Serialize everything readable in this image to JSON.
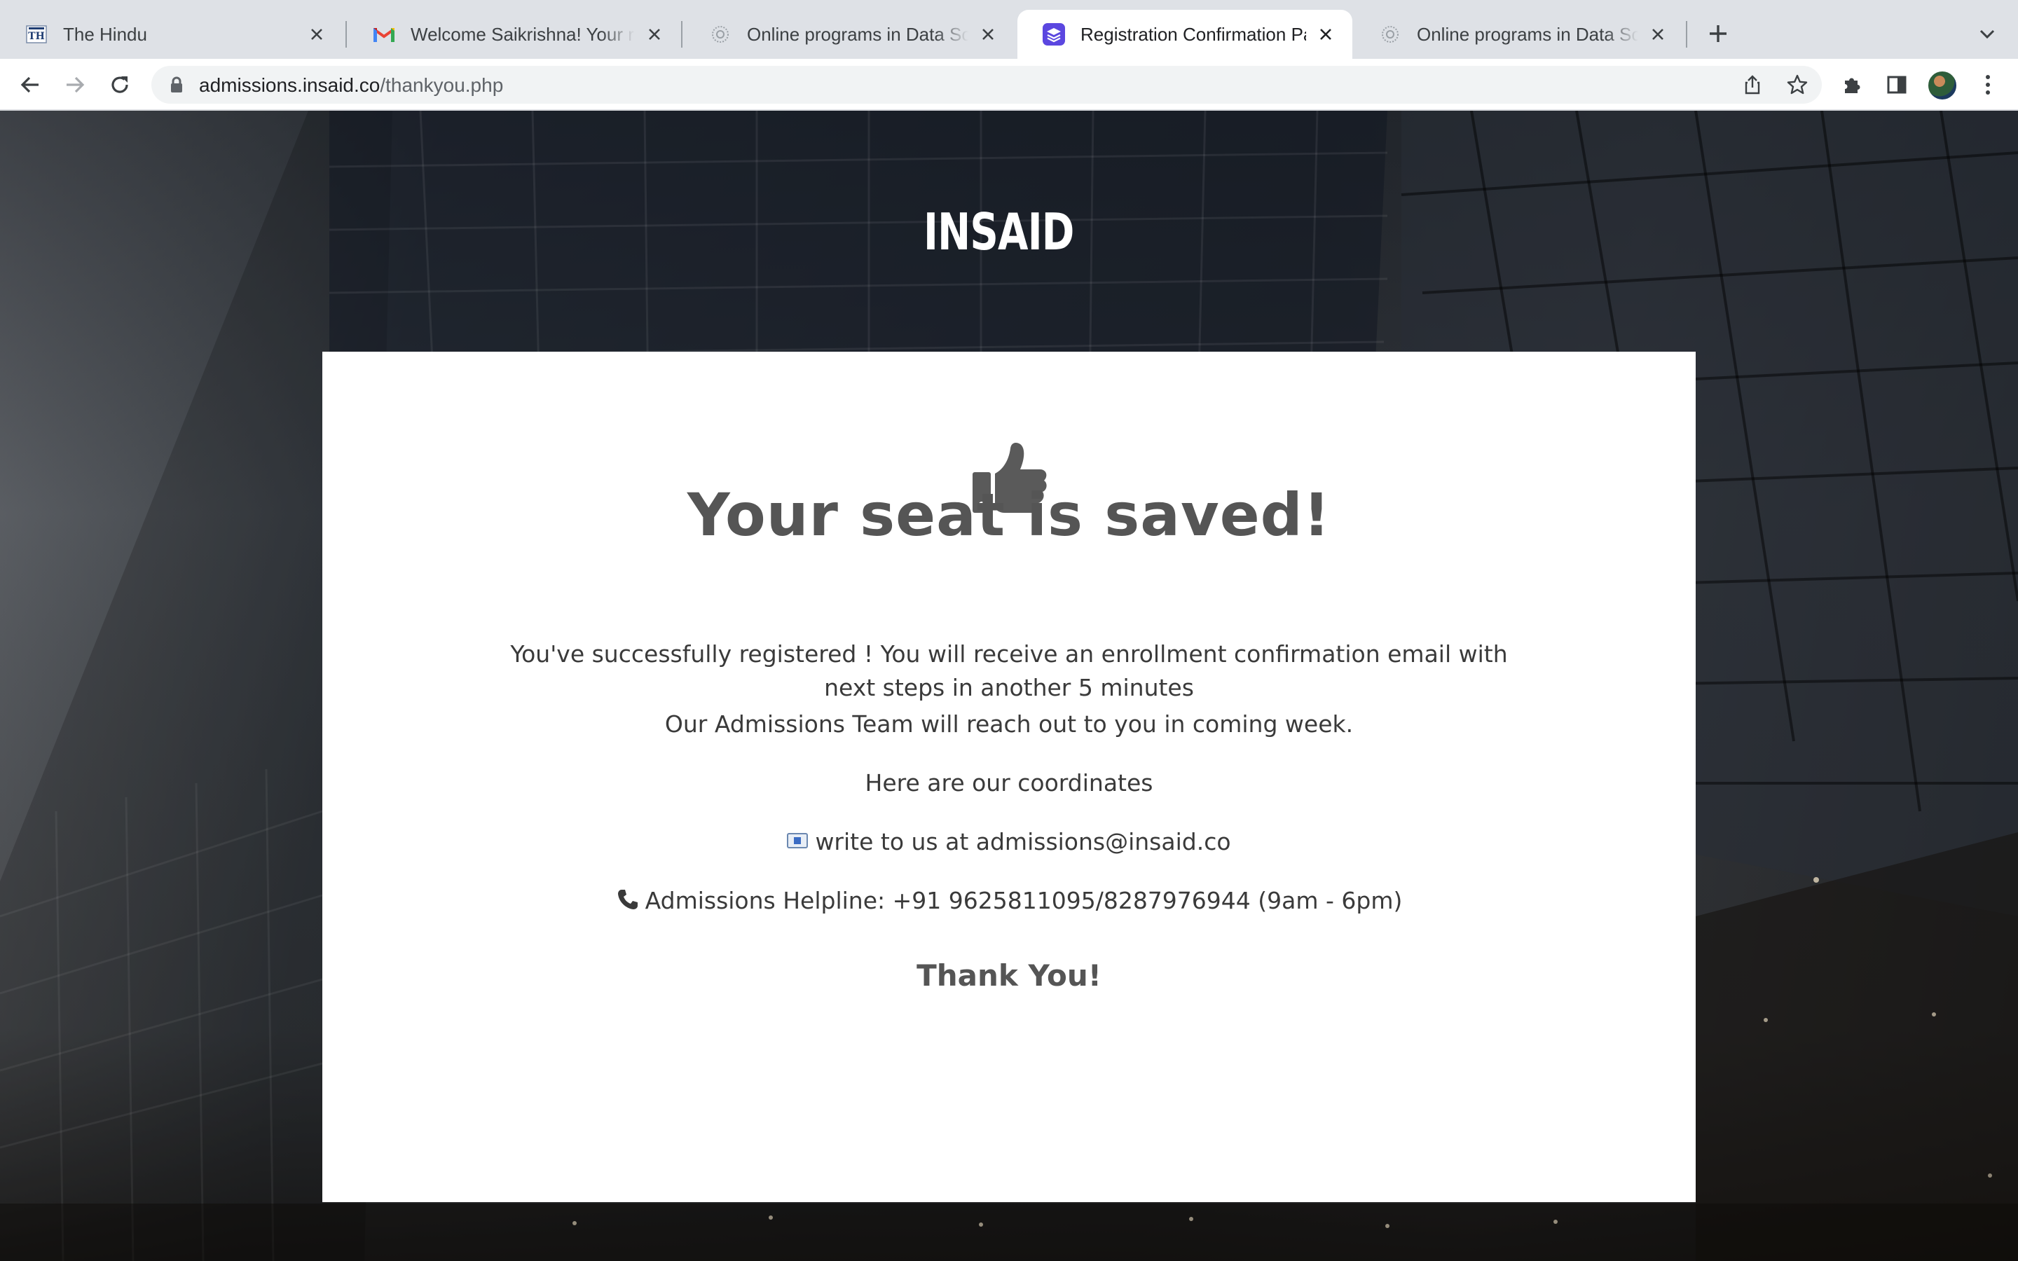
{
  "browser": {
    "tabs": [
      {
        "title": "The Hindu",
        "favicon": "the-hindu-favicon",
        "active": false
      },
      {
        "title": "Welcome Saikrishna! Your registration",
        "favicon": "gmail-favicon",
        "active": false
      },
      {
        "title": "Online programs in Data Science",
        "favicon": "insaid-favicon",
        "active": false
      },
      {
        "title": "Registration Confirmation Page",
        "favicon": "stack-favicon",
        "active": true
      },
      {
        "title": "Online programs in Data Science",
        "favicon": "insaid-favicon",
        "active": false
      }
    ],
    "address": {
      "domain": "admissions.insaid.co",
      "path": "/thankyou.php"
    }
  },
  "page": {
    "logo_text": "INSAID",
    "headline": "Your seat is saved!",
    "message": "You've successfully registered  ! You will receive an enrollment confirmation email with next steps in another 5 minutes",
    "team_note": "Our Admissions Team will reach out to you in coming week.",
    "coordinates_intro": "Here are our coordinates",
    "email_line": "write to us at admissions@insaid.co",
    "helpline_line": "Admissions Helpline: +91 9625811095/8287976944 (9am - 6pm)",
    "thanks": "Thank You!"
  },
  "colors": {
    "tabstrip": "#dee1e6",
    "card": "#ffffff",
    "headline": "#555555",
    "text": "#3a3a3a"
  }
}
